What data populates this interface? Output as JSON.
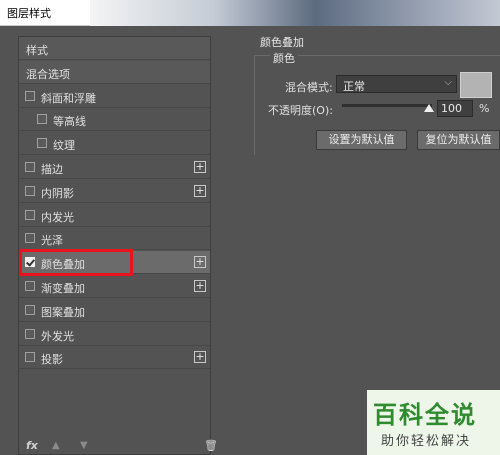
{
  "window": {
    "title": "图层样式"
  },
  "left_panel": {
    "items": [
      {
        "label": "样式",
        "checkbox": false,
        "checked": false,
        "indent": 0,
        "plus": false,
        "header": true
      },
      {
        "label": "混合选项",
        "checkbox": false,
        "checked": false,
        "indent": 0,
        "plus": false,
        "header": true
      },
      {
        "label": "斜面和浮雕",
        "checkbox": true,
        "checked": false,
        "indent": 0,
        "plus": false
      },
      {
        "label": "等高线",
        "checkbox": true,
        "checked": false,
        "indent": 1,
        "plus": false
      },
      {
        "label": "纹理",
        "checkbox": true,
        "checked": false,
        "indent": 1,
        "plus": false
      },
      {
        "label": "描边",
        "checkbox": true,
        "checked": false,
        "indent": 0,
        "plus": true
      },
      {
        "label": "内阴影",
        "checkbox": true,
        "checked": false,
        "indent": 0,
        "plus": true
      },
      {
        "label": "内发光",
        "checkbox": true,
        "checked": false,
        "indent": 0,
        "plus": false
      },
      {
        "label": "光泽",
        "checkbox": true,
        "checked": false,
        "indent": 0,
        "plus": false
      },
      {
        "label": "颜色叠加",
        "checkbox": true,
        "checked": true,
        "indent": 0,
        "plus": true,
        "selected": true
      },
      {
        "label": "渐变叠加",
        "checkbox": true,
        "checked": false,
        "indent": 0,
        "plus": true
      },
      {
        "label": "图案叠加",
        "checkbox": true,
        "checked": false,
        "indent": 0,
        "plus": false
      },
      {
        "label": "外发光",
        "checkbox": true,
        "checked": false,
        "indent": 0,
        "plus": false
      },
      {
        "label": "投影",
        "checkbox": true,
        "checked": false,
        "indent": 0,
        "plus": true
      }
    ],
    "bottom": {
      "fx": "fx"
    }
  },
  "color_overlay": {
    "section_title": "颜色叠加",
    "group_title": "颜色",
    "blend_mode_label": "混合模式:",
    "blend_mode_value": "正常",
    "swatch_color": "#b3b3b3",
    "opacity_label": "不透明度(O):",
    "opacity_value": "100",
    "opacity_unit": "%",
    "opacity_fraction": 1.0,
    "set_default_label": "设置为默认值",
    "reset_default_label": "复位为默认值"
  },
  "watermark": {
    "big": "百科全说",
    "small": "助你轻松解决"
  }
}
